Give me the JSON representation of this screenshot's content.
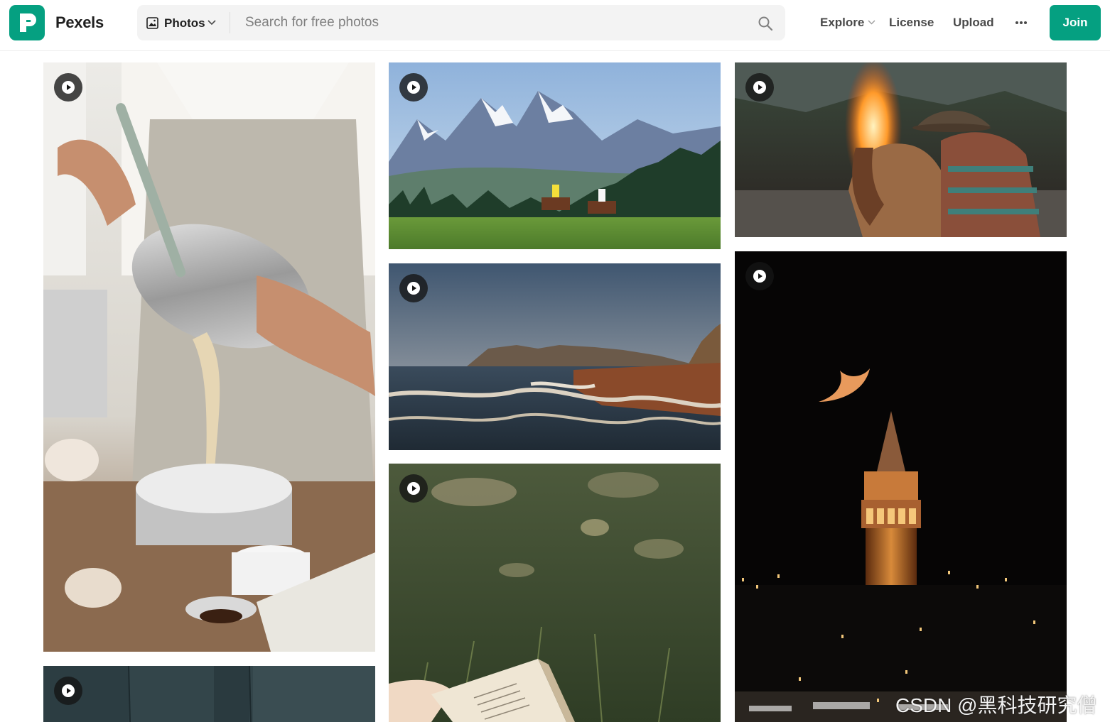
{
  "header": {
    "brand": "Pexels",
    "media_type": "Photos",
    "search_placeholder": "Search for free photos",
    "nav": {
      "explore": "Explore",
      "license": "License",
      "upload": "Upload",
      "more": "···",
      "join": "Join"
    }
  },
  "colors": {
    "brand_green": "#05a081",
    "search_bg": "#f3f3f3"
  },
  "gallery": [
    {
      "subject": "baking-batter-pour",
      "icon": "play-icon"
    },
    {
      "subject": "mountain-horse-riders",
      "icon": "play-icon"
    },
    {
      "subject": "cowboy-horse-fire",
      "icon": "play-icon"
    },
    {
      "subject": "coastal-waves-sunset",
      "icon": "play-icon"
    },
    {
      "subject": "galata-tower-crescent-moon",
      "icon": "play-icon"
    },
    {
      "subject": "grass-open-book",
      "icon": "play-icon"
    },
    {
      "subject": "dark-teal-wood",
      "icon": "play-icon"
    }
  ],
  "watermark": "CSDN @黑科技研究僧"
}
